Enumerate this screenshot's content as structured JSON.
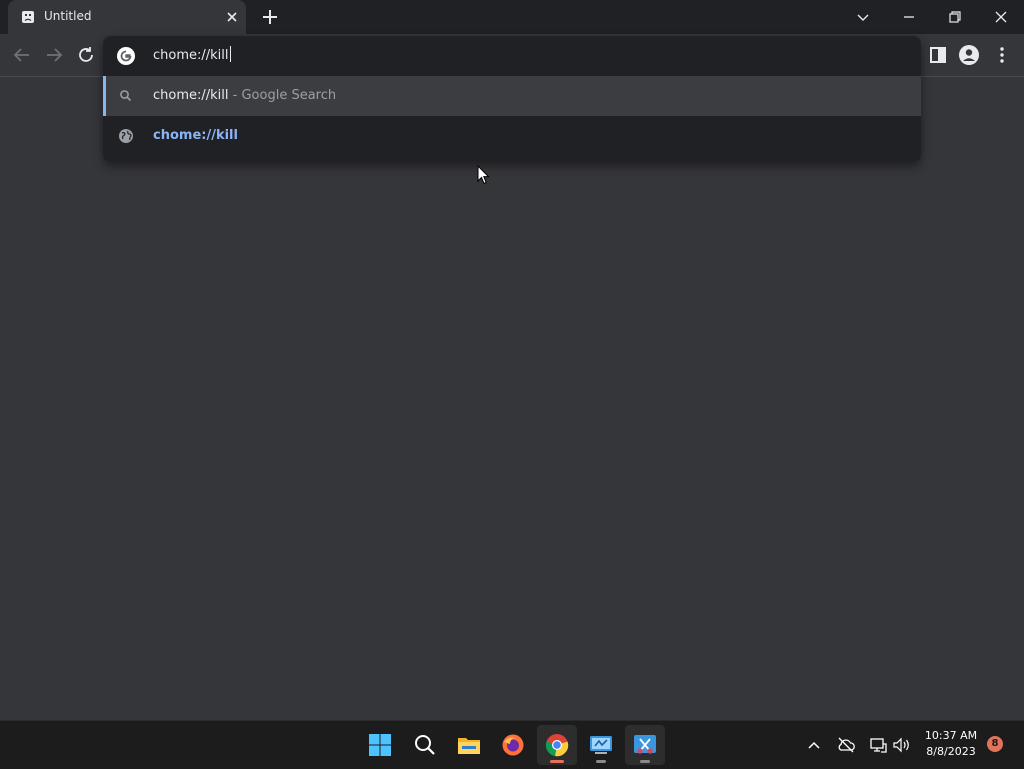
{
  "window": {
    "tab_title": "Untitled",
    "tab_favicon": "sad-page-icon",
    "controls": [
      "chevron-down-icon",
      "minimize-icon",
      "restore-icon",
      "close-icon"
    ]
  },
  "toolbar": {
    "nav_icons": [
      "back-arrow-icon",
      "forward-arrow-icon",
      "reload-icon"
    ],
    "right_icons": [
      "side-panel-icon",
      "profile-icon",
      "kebab-menu-icon"
    ]
  },
  "omnibox": {
    "input_value": "chome://kill",
    "suggestions": [
      {
        "icon": "search-icon",
        "text": "chome://kill",
        "separator": " - ",
        "description": "Google Search"
      },
      {
        "icon": "globe-icon",
        "text": "chome://kill"
      }
    ]
  },
  "taskbar": {
    "apps": [
      "windows-start-icon",
      "search-icon",
      "file-explorer-icon",
      "firefox-icon",
      "chrome-icon",
      "control-panel-icon",
      "snipping-tool-icon"
    ],
    "tray_icons": [
      "chevron-up-icon",
      "cloud-offline-icon",
      "network-icon",
      "volume-icon"
    ],
    "time": "10:37 AM",
    "date": "8/8/2023",
    "notification_count": "8"
  },
  "colors": {
    "accent_blue": "#8ab4f8",
    "tabstrip_bg": "#202124",
    "page_bg": "#35363a",
    "taskbar_bg": "#1c1c1c",
    "notification_badge": "#e0735a"
  }
}
